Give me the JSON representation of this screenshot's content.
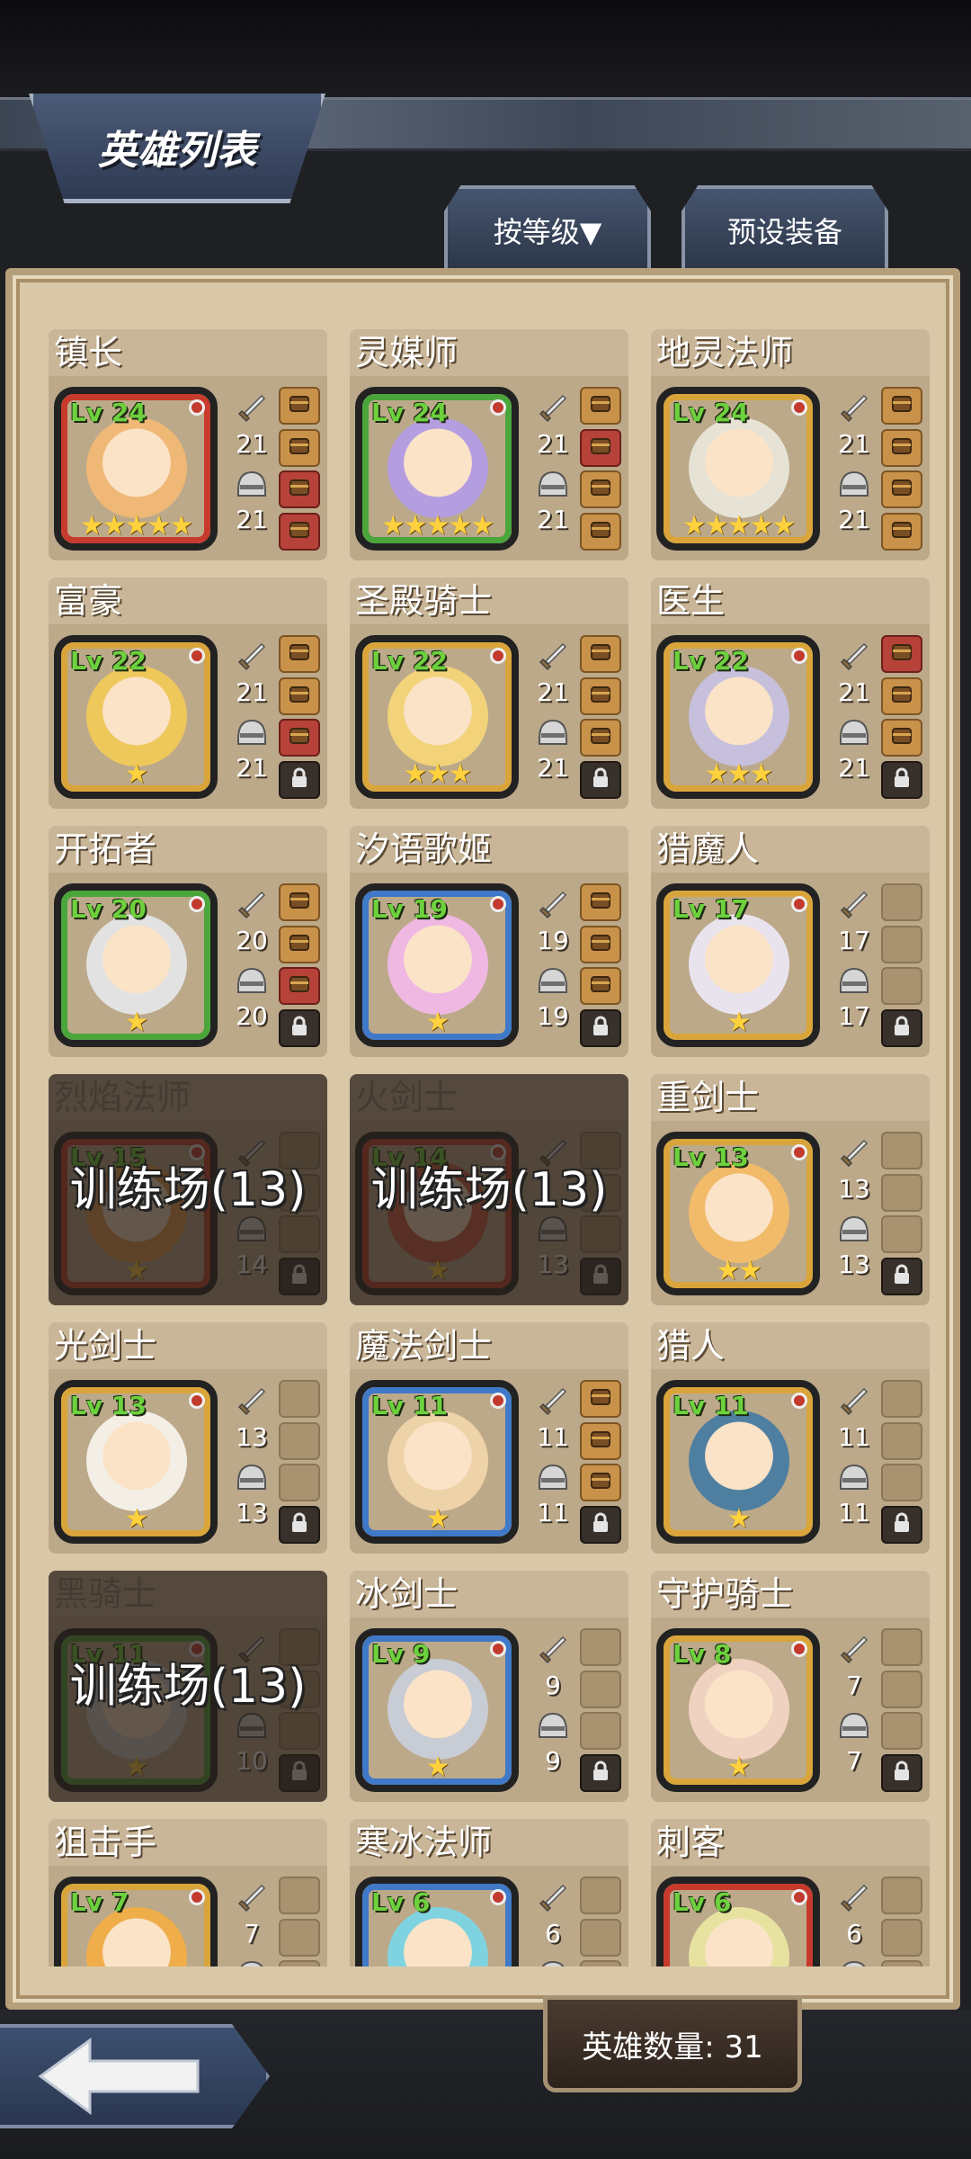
{
  "header": {
    "title": "英雄列表"
  },
  "tabs": {
    "sort_label": "按等级▼",
    "preset_label": "预设装备"
  },
  "heroes": [
    {
      "name": "镇长",
      "level": "Lv 24",
      "atk": "21",
      "def": "21",
      "stars": 5,
      "frame": "red",
      "face": "#f0b876",
      "slots": [
        "filled",
        "filled",
        "red",
        "red"
      ]
    },
    {
      "name": "灵媒师",
      "level": "Lv 24",
      "atk": "21",
      "def": "21",
      "stars": 5,
      "frame": "green",
      "face": "#b49ee0",
      "slots": [
        "filled",
        "red",
        "filled",
        "filled"
      ]
    },
    {
      "name": "地灵法师",
      "level": "Lv 24",
      "atk": "21",
      "def": "21",
      "stars": 5,
      "frame": "gold",
      "face": "#e6e3d6",
      "slots": [
        "filled",
        "filled",
        "filled",
        "filled"
      ]
    },
    {
      "name": "富豪",
      "level": "Lv 22",
      "atk": "21",
      "def": "21",
      "stars": 1,
      "frame": "gold",
      "face": "#efc85c",
      "slots": [
        "filled",
        "filled",
        "red",
        "locked"
      ]
    },
    {
      "name": "圣殿骑士",
      "level": "Lv 22",
      "atk": "21",
      "def": "21",
      "stars": 3,
      "frame": "gold",
      "face": "#f2d37a",
      "slots": [
        "filled",
        "filled",
        "filled",
        "locked"
      ]
    },
    {
      "name": "医生",
      "level": "Lv 22",
      "atk": "21",
      "def": "21",
      "stars": 3,
      "frame": "gold",
      "face": "#c6c0dc",
      "slots": [
        "red",
        "filled",
        "filled",
        "locked"
      ]
    },
    {
      "name": "开拓者",
      "level": "Lv 20",
      "atk": "20",
      "def": "20",
      "stars": 1,
      "frame": "green",
      "face": "#e2e2e2",
      "slots": [
        "filled",
        "filled",
        "red",
        "locked"
      ]
    },
    {
      "name": "汐语歌姬",
      "level": "Lv 19",
      "atk": "19",
      "def": "19",
      "stars": 1,
      "frame": "blue",
      "face": "#efb8e2",
      "slots": [
        "filled",
        "filled",
        "filled",
        "locked"
      ]
    },
    {
      "name": "猎魔人",
      "level": "Lv 17",
      "atk": "17",
      "def": "17",
      "stars": 1,
      "frame": "gold",
      "face": "#e9e3ee",
      "slots": [
        "empty",
        "empty",
        "empty",
        "locked"
      ]
    },
    {
      "name": "烈焰法师",
      "level": "Lv 15",
      "atk": "",
      "def": "14",
      "stars": 1,
      "frame": "red",
      "face": "#e79a4e",
      "slots": [
        "empty",
        "empty",
        "empty",
        "locked"
      ],
      "training": "训练场(13)"
    },
    {
      "name": "火剑士",
      "level": "Lv 14",
      "atk": "",
      "def": "13",
      "stars": 1,
      "frame": "red",
      "face": "#d0583e",
      "slots": [
        "empty",
        "empty",
        "empty",
        "locked"
      ],
      "training": "训练场(13)"
    },
    {
      "name": "重剑士",
      "level": "Lv 13",
      "atk": "13",
      "def": "13",
      "stars": 2,
      "frame": "gold",
      "face": "#f2bb6a",
      "slots": [
        "empty",
        "empty",
        "empty",
        "locked"
      ]
    },
    {
      "name": "光剑士",
      "level": "Lv 13",
      "atk": "13",
      "def": "13",
      "stars": 1,
      "frame": "gold",
      "face": "#f3efe6",
      "slots": [
        "empty",
        "empty",
        "empty",
        "locked"
      ]
    },
    {
      "name": "魔法剑士",
      "level": "Lv 11",
      "atk": "11",
      "def": "11",
      "stars": 1,
      "frame": "blue",
      "face": "#eed2a8",
      "slots": [
        "filled",
        "filled",
        "filled",
        "locked"
      ]
    },
    {
      "name": "猎人",
      "level": "Lv 11",
      "atk": "11",
      "def": "11",
      "stars": 1,
      "frame": "gold",
      "face": "#4e7fa0",
      "slots": [
        "empty",
        "empty",
        "empty",
        "locked"
      ]
    },
    {
      "name": "黑骑士",
      "level": "Lv 11",
      "atk": "",
      "def": "10",
      "stars": 1,
      "frame": "green",
      "face": "#cfcfcf",
      "slots": [
        "empty",
        "empty",
        "empty",
        "locked"
      ],
      "training": "训练场(13)"
    },
    {
      "name": "冰剑士",
      "level": "Lv 9",
      "atk": "9",
      "def": "9",
      "stars": 1,
      "frame": "blue",
      "face": "#c8ccd4",
      "slots": [
        "empty",
        "empty",
        "empty",
        "locked"
      ]
    },
    {
      "name": "守护骑士",
      "level": "Lv 8",
      "atk": "7",
      "def": "7",
      "stars": 1,
      "frame": "gold",
      "face": "#f0d2c0",
      "slots": [
        "empty",
        "empty",
        "empty",
        "locked"
      ]
    },
    {
      "name": "狙击手",
      "level": "Lv 7",
      "atk": "7",
      "def": "",
      "stars": 0,
      "frame": "gold",
      "face": "#efae4a",
      "slots": [
        "empty",
        "empty",
        "empty",
        "empty"
      ]
    },
    {
      "name": "寒冰法师",
      "level": "Lv 6",
      "atk": "6",
      "def": "",
      "stars": 0,
      "frame": "blue",
      "face": "#7fd3e0",
      "slots": [
        "empty",
        "empty",
        "empty",
        "empty"
      ]
    },
    {
      "name": "刺客",
      "level": "Lv 6",
      "atk": "6",
      "def": "",
      "stars": 0,
      "frame": "red",
      "face": "#e8e2a0",
      "slots": [
        "empty",
        "empty",
        "empty",
        "empty"
      ]
    }
  ],
  "footer": {
    "hero_count": "英雄数量: 31"
  }
}
